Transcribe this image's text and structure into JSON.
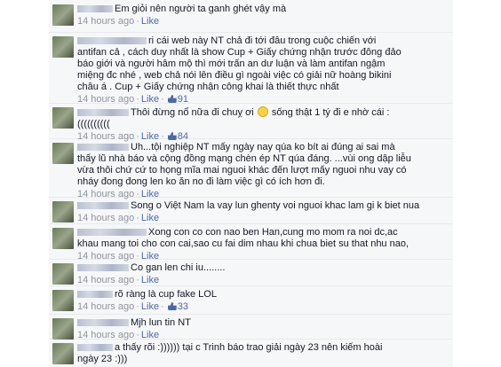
{
  "comments": [
    {
      "lines": [
        "Em giỏi nên người ta ganh ghét vậy mà"
      ],
      "time": "14 hours ago",
      "like": "Like"
    },
    {
      "lines": [
        "ri cái web này NT chả đi tới đâu trong cuộc chiến với",
        "antifan cả , cách duy nhất là show Cup + Giấy chứng nhận trước đông đảo",
        "báo giới và người hâm mộ thì mới trấn an dư luận và làm antifan ngậm",
        "miệng đc nhé , web chả nói lên điều gì ngoài việc có giải nữ hoàng bikini",
        "châu á . Cup + Giấy chứng nhận công khai là thiết thực nhất"
      ],
      "time": "14 hours ago",
      "like": "Like",
      "likes": "91"
    },
    {
      "lines": [
        "Thôi đừng nổ nữa đi chuỵ ơi",
        "(((((((((("
      ],
      "emoji_after": "sống thật 1 tý đi e nhờ cái :",
      "time": "14 hours ago",
      "like": "Like",
      "likes": "84"
    },
    {
      "lines": [
        "Uh...tội nghiệp NT mấy ngày nay qúa ko bít ai đúng ai sai mà",
        "thấy lũ nhà báo và cộng đồng mạng chèn ép NT qúa đáng. ...vùi ong dập liễu",
        "vừa thôi chứ cứ to họng mĩa mai nguoi khác đến lượt mấy nguoi nhu vay có",
        "nháy đong đong len ko ăn no đi làm việc gì có ích hơn đi."
      ],
      "time": "14 hours ago",
      "like": "Like"
    },
    {
      "lines": [
        "Song o Việt Nam la vay lun ghenty voi nguoi khac lam gi k biet nua"
      ],
      "time": "14 hours ago",
      "like": "Like"
    },
    {
      "lines": [
        "Xong con co con nao ben Han,cung mo mom ra noi dc,ac",
        "khau mang toi cho con cai,sao cu fai dim nhau khi chua biet su that nhu nao,"
      ],
      "time": "14 hours ago",
      "like": "Like"
    },
    {
      "lines": [
        "Co gan len chi iu........"
      ],
      "time": "14 hours ago",
      "like": "Like"
    },
    {
      "lines": [
        "rõ ràng là cup fake LOL"
      ],
      "time": "14 hours ago",
      "like": "Like",
      "likes": "33"
    },
    {
      "lines": [
        "Mjh lun tin NT"
      ],
      "time": "14 hours ago",
      "like": "Like"
    },
    {
      "lines": [
        "a thấy rõi :)))))) tại c Trinh báo trao giải ngày 23 nên kiếm hoài",
        "ngày 23 :)))"
      ]
    }
  ]
}
